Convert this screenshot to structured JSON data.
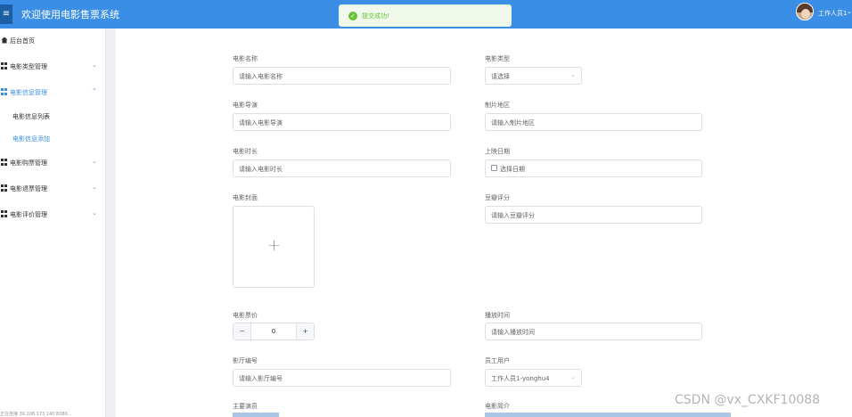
{
  "header": {
    "menu_icon": "hamburger-icon",
    "title": "欢迎使用电影售票系统",
    "user_name": "工作人员1",
    "user_chevron": "chevron-down-icon"
  },
  "toast": {
    "icon": "check-circle-icon",
    "message": "提交成功!",
    "color": "#67c23a"
  },
  "sidebar": {
    "items": [
      {
        "label": "后台首页",
        "icon": "home-icon"
      },
      {
        "label": "电影类型管理",
        "icon": "grid-icon"
      },
      {
        "label": "电影信息管理",
        "icon": "grid-icon",
        "active": true
      },
      {
        "label": "电影购票管理",
        "icon": "grid-icon"
      },
      {
        "label": "电影退票管理",
        "icon": "grid-icon"
      },
      {
        "label": "电影评价管理",
        "icon": "grid-icon"
      }
    ],
    "sub_items": [
      {
        "label": "电影信息列表"
      },
      {
        "label": "电影信息添加",
        "active": true
      }
    ]
  },
  "form": {
    "name": {
      "label": "电影名称",
      "placeholder": "请输入电影名称"
    },
    "type": {
      "label": "电影类型",
      "placeholder": "请选择"
    },
    "director": {
      "label": "电影导演",
      "placeholder": "请输入电影导演"
    },
    "region": {
      "label": "制片地区",
      "placeholder": "请输入制片地区"
    },
    "duration": {
      "label": "电影时长",
      "placeholder": "请输入电影时长"
    },
    "release": {
      "label": "上映日期",
      "placeholder": "选择日期"
    },
    "cover": {
      "label": "电影封面"
    },
    "douban": {
      "label": "豆瓣评分",
      "placeholder": "请输入豆瓣评分"
    },
    "price": {
      "label": "电影票价",
      "value": "0",
      "minus": "−",
      "plus": "+"
    },
    "showtime": {
      "label": "播放时间",
      "placeholder": "请输入播放时间"
    },
    "hall": {
      "label": "影厅编号",
      "placeholder": "请输入影厅编号"
    },
    "staff": {
      "label": "员工用户",
      "value": "工作人员1-yonghu4"
    },
    "actors": {
      "label": "主要演员"
    },
    "intro": {
      "label": "电影简介"
    }
  },
  "watermark": "CSDN @vx_CXKF10088",
  "status_text": "正在连接 39.108.173.140:8080..."
}
